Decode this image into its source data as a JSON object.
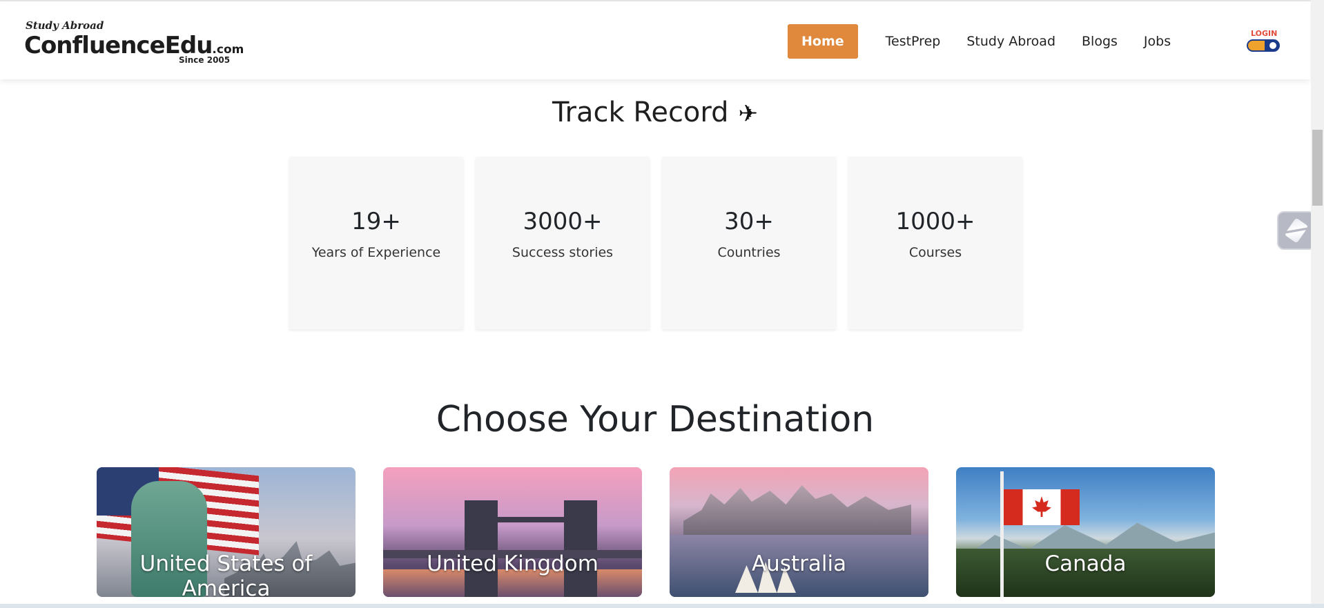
{
  "navbar": {
    "logo": {
      "tagline": "Study Abroad",
      "brand": "ConfluenceEdu",
      "domain": ".com",
      "since": "Since 2005"
    },
    "links": [
      {
        "label": "Home",
        "active": true
      },
      {
        "label": "TestPrep",
        "active": false
      },
      {
        "label": "Study Abroad",
        "active": false
      },
      {
        "label": "Blogs",
        "active": false
      },
      {
        "label": "Jobs",
        "active": false
      }
    ],
    "login": {
      "label": "LOGIN",
      "icon": "lock-toggle-icon"
    },
    "accent_color": "#e0893d"
  },
  "track_record": {
    "title": "Track Record",
    "title_icon": "airplane-icon",
    "stats": [
      {
        "value": "19+",
        "label": "Years of Experience"
      },
      {
        "value": "3000+",
        "label": "Success stories"
      },
      {
        "value": "30+",
        "label": "Countries"
      },
      {
        "value": "1000+",
        "label": "Courses"
      }
    ]
  },
  "destinations": {
    "title": "Choose Your Destination",
    "cards": [
      {
        "name": "United States of America",
        "image": "usa-statue-of-liberty-image"
      },
      {
        "name": "United Kingdom",
        "image": "uk-tower-bridge-image"
      },
      {
        "name": "Australia",
        "image": "australia-sydney-opera-house-image"
      },
      {
        "name": "Canada",
        "image": "canada-flag-mountains-image"
      }
    ]
  },
  "floating_widget": {
    "icon": "chat-widget-icon"
  }
}
